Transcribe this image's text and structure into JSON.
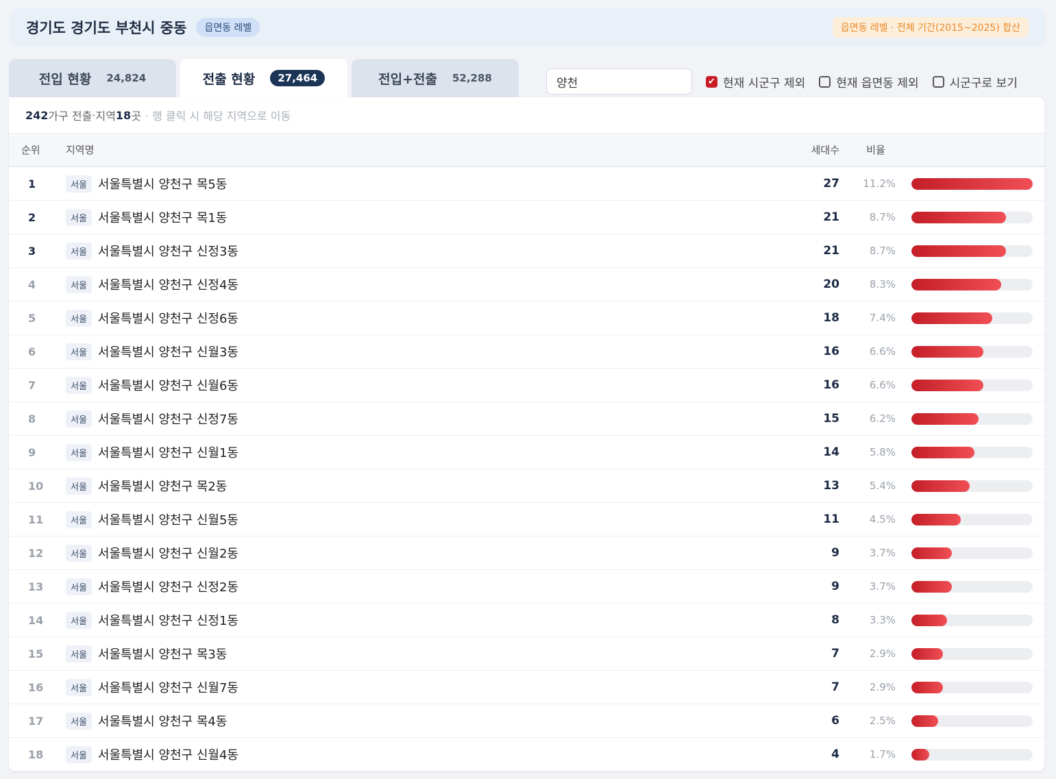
{
  "header": {
    "title": "경기도 경기도 부천시 중동",
    "level_badge": "읍면동 레벨",
    "period": "읍면동 레벨 · 전체 기간(2015~2025) 합산"
  },
  "tabs": [
    {
      "label": "전입 현황",
      "count": "24,824",
      "active": false
    },
    {
      "label": "전출 현황",
      "count": "27,464",
      "active": true
    },
    {
      "label": "전입+전출",
      "count": "52,288",
      "active": false
    }
  ],
  "filter": {
    "search_value": "양천",
    "checks": [
      {
        "label": "현재 시군구 제외",
        "checked": true
      },
      {
        "label": "현재 읍면동 제외",
        "checked": false
      },
      {
        "label": "시군구로 보기",
        "checked": false
      }
    ]
  },
  "summary": {
    "households": "242",
    "households_suffix": "가구 전출",
    "sep": " · ",
    "region_label": "지역 ",
    "regions": "18",
    "regions_suffix": "곳",
    "hint": "· 행 클릭 시 해당 지역으로 이동"
  },
  "columns": {
    "rank": "순위",
    "name": "지역명",
    "count": "세대수",
    "ratio": "비율"
  },
  "rows": [
    {
      "rank": "1",
      "badge": "서울",
      "name": "서울특별시 양천구 목5동",
      "count": 27,
      "pct": "11.2%"
    },
    {
      "rank": "2",
      "badge": "서울",
      "name": "서울특별시 양천구 목1동",
      "count": 21,
      "pct": "8.7%"
    },
    {
      "rank": "3",
      "badge": "서울",
      "name": "서울특별시 양천구 신정3동",
      "count": 21,
      "pct": "8.7%"
    },
    {
      "rank": "4",
      "badge": "서울",
      "name": "서울특별시 양천구 신정4동",
      "count": 20,
      "pct": "8.3%"
    },
    {
      "rank": "5",
      "badge": "서울",
      "name": "서울특별시 양천구 신정6동",
      "count": 18,
      "pct": "7.4%"
    },
    {
      "rank": "6",
      "badge": "서울",
      "name": "서울특별시 양천구 신월3동",
      "count": 16,
      "pct": "6.6%"
    },
    {
      "rank": "7",
      "badge": "서울",
      "name": "서울특별시 양천구 신월6동",
      "count": 16,
      "pct": "6.6%"
    },
    {
      "rank": "8",
      "badge": "서울",
      "name": "서울특별시 양천구 신정7동",
      "count": 15,
      "pct": "6.2%"
    },
    {
      "rank": "9",
      "badge": "서울",
      "name": "서울특별시 양천구 신월1동",
      "count": 14,
      "pct": "5.8%"
    },
    {
      "rank": "10",
      "badge": "서울",
      "name": "서울특별시 양천구 목2동",
      "count": 13,
      "pct": "5.4%"
    },
    {
      "rank": "11",
      "badge": "서울",
      "name": "서울특별시 양천구 신월5동",
      "count": 11,
      "pct": "4.5%"
    },
    {
      "rank": "12",
      "badge": "서울",
      "name": "서울특별시 양천구 신월2동",
      "count": 9,
      "pct": "3.7%"
    },
    {
      "rank": "13",
      "badge": "서울",
      "name": "서울특별시 양천구 신정2동",
      "count": 9,
      "pct": "3.7%"
    },
    {
      "rank": "14",
      "badge": "서울",
      "name": "서울특별시 양천구 신정1동",
      "count": 8,
      "pct": "3.3%"
    },
    {
      "rank": "15",
      "badge": "서울",
      "name": "서울특별시 양천구 목3동",
      "count": 7,
      "pct": "2.9%"
    },
    {
      "rank": "16",
      "badge": "서울",
      "name": "서울특별시 양천구 신월7동",
      "count": 7,
      "pct": "2.9%"
    },
    {
      "rank": "17",
      "badge": "서울",
      "name": "서울특별시 양천구 목4동",
      "count": 6,
      "pct": "2.5%"
    },
    {
      "rank": "18",
      "badge": "서울",
      "name": "서울특별시 양천구 신월4동",
      "count": 4,
      "pct": "1.7%"
    }
  ]
}
